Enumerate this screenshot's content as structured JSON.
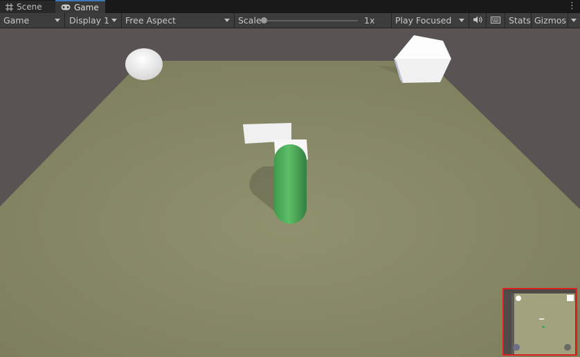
{
  "tabs": [
    {
      "label": "Scene",
      "icon": "scene-grid-icon"
    },
    {
      "label": "Game",
      "icon": "game-controller-icon",
      "active": true
    }
  ],
  "toolbar": {
    "view_select": "Game",
    "display_select": "Display 1",
    "aspect_select": "Free Aspect",
    "scale_label": "Scale",
    "scale_value": "1x",
    "play_mode_select": "Play Focused",
    "audio_icon": "speaker-icon",
    "keyboard_icon": "keyboard-icon",
    "stats_label": "Stats",
    "gizmos_label": "Gizmos"
  },
  "scale_slider": {
    "value": 1,
    "min": 1,
    "max": 16
  },
  "scene_objects": [
    {
      "name": "sphere",
      "color": "#ffffff"
    },
    {
      "name": "cube",
      "color": "#ffffff"
    },
    {
      "name": "small-box",
      "color": "#ffffff"
    },
    {
      "name": "player-capsule",
      "color": "#4caf5a"
    },
    {
      "name": "ground-plane",
      "color": "#8a8a65"
    }
  ],
  "minimap": {
    "highlight_color": "#e02020"
  },
  "colors": {
    "accent": "#3a79bb",
    "background": "#595252",
    "ground": "#8a8a65"
  }
}
